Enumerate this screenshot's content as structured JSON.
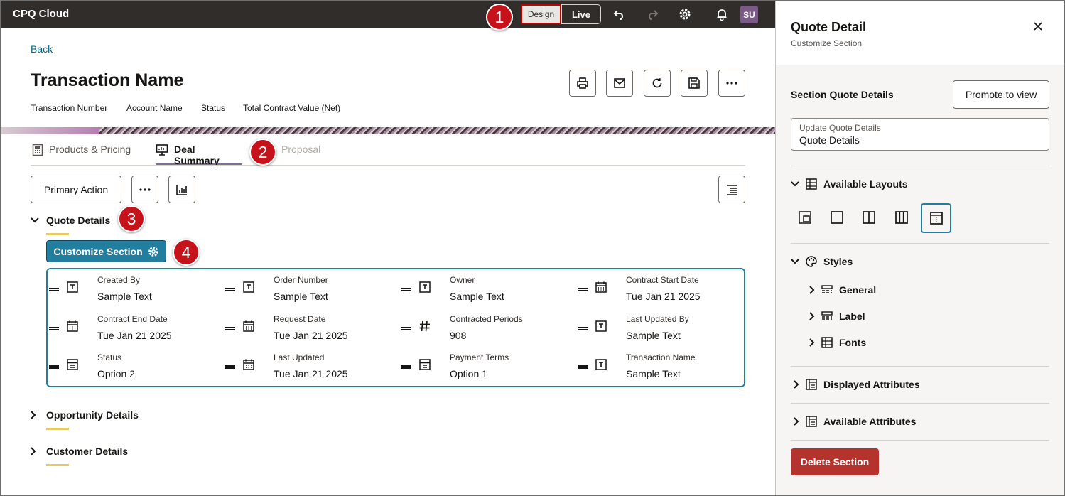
{
  "topbar": {
    "app_title": "CPQ Cloud",
    "mode_design": "Design",
    "mode_live": "Live",
    "avatar": "SU"
  },
  "markers": [
    "1",
    "2",
    "3",
    "4"
  ],
  "page": {
    "back": "Back",
    "title": "Transaction Name",
    "meta": [
      "Transaction Number",
      "Account Name",
      "Status",
      "Total Contract Value (Net)"
    ],
    "icons": [
      "print-icon",
      "email-icon",
      "refresh-icon",
      "save-icon",
      "more-icon"
    ]
  },
  "tabs": [
    {
      "label": "Products & Pricing",
      "icon": "calculator-icon",
      "state": "inactive"
    },
    {
      "label": "Deal Summary",
      "icon": "presentation-icon",
      "state": "active"
    },
    {
      "label": "Proposal",
      "icon": "",
      "state": "faded"
    }
  ],
  "toolbar": {
    "primary_action": "Primary Action",
    "more": "···"
  },
  "sections": {
    "quote_details": "Quote Details",
    "customize": "Customize Section",
    "opportunity_details": "Opportunity Details",
    "customer_details": "Customer Details"
  },
  "fields": [
    {
      "label": "Created By",
      "value": "Sample Text",
      "type": "text"
    },
    {
      "label": "Order Number",
      "value": "Sample Text",
      "type": "text"
    },
    {
      "label": "Owner",
      "value": "Sample Text",
      "type": "text"
    },
    {
      "label": "Contract Start Date",
      "value": "Tue Jan 21 2025",
      "type": "date"
    },
    {
      "label": "Contract End Date",
      "value": "Tue Jan 21 2025",
      "type": "date"
    },
    {
      "label": "Request Date",
      "value": "Tue Jan 21 2025",
      "type": "date"
    },
    {
      "label": "Contracted Periods",
      "value": "908",
      "type": "number"
    },
    {
      "label": "Last Updated By",
      "value": "Sample Text",
      "type": "text"
    },
    {
      "label": "Status",
      "value": "Option 2",
      "type": "select"
    },
    {
      "label": "Last Updated",
      "value": "Tue Jan 21 2025",
      "type": "date"
    },
    {
      "label": "Payment Terms",
      "value": "Option 1",
      "type": "select"
    },
    {
      "label": "Transaction Name",
      "value": "Sample Text",
      "type": "text"
    }
  ],
  "panel": {
    "title": "Quote Detail",
    "subtitle": "Customize Section",
    "section_label": "Section Quote Details",
    "promote": "Promote to view",
    "input_label": "Update Quote Details",
    "input_value": "Quote Details",
    "available_layouts": "Available Layouts",
    "styles": "Styles",
    "general": "General",
    "label": "Label",
    "fonts": "Fonts",
    "displayed_attributes": "Displayed Attributes",
    "available_attributes": "Available Attributes",
    "delete": "Delete Section",
    "selected_layout": 4
  },
  "colors": {
    "topbar": "#312d2a",
    "accent": "#227e9e",
    "danger": "#b5322d",
    "marker": "#c5121b",
    "underline": "#e6c968"
  }
}
